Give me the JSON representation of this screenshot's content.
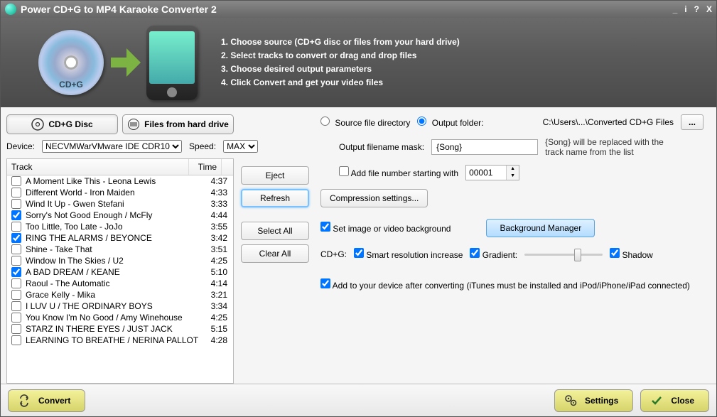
{
  "title": "Power CD+G to MP4 Karaoke Converter 2",
  "steps": [
    "1. Choose source (CD+G disc or files from your hard drive)",
    "2. Select tracks to convert or drag and drop files",
    "3. Choose desired output parameters",
    "4. Click Convert and get your video files"
  ],
  "source_buttons": {
    "disc": "CD+G Disc",
    "files": "Files from hard drive"
  },
  "device_label": "Device:",
  "device_value": "NECVMWarVMware IDE CDR10",
  "speed_label": "Speed:",
  "speed_value": "MAX",
  "columns": {
    "track": "Track",
    "time": "Time"
  },
  "tracks": [
    {
      "name": "A Moment Like This - Leona Lewis",
      "time": "4:37",
      "checked": false
    },
    {
      "name": "Different World - Iron Maiden",
      "time": "4:33",
      "checked": false
    },
    {
      "name": "Wind It Up - Gwen Stefani",
      "time": "3:33",
      "checked": false
    },
    {
      "name": "Sorry's Not Good Enough / McFly",
      "time": "4:44",
      "checked": true
    },
    {
      "name": "Too Little, Too Late - JoJo",
      "time": "3:55",
      "checked": false
    },
    {
      "name": "RING THE ALARMS / BEYONCE",
      "time": "3:42",
      "checked": true
    },
    {
      "name": "Shine - Take That",
      "time": "3:51",
      "checked": false
    },
    {
      "name": "Window In The Skies / U2",
      "time": "4:25",
      "checked": false
    },
    {
      "name": "A BAD DREAM / KEANE",
      "time": "5:10",
      "checked": true
    },
    {
      "name": "Raoul - The Automatic",
      "time": "4:14",
      "checked": false
    },
    {
      "name": "Grace Kelly - Mika",
      "time": "3:21",
      "checked": false
    },
    {
      "name": "I LUV U / THE ORDINARY BOYS",
      "time": "3:34",
      "checked": false
    },
    {
      "name": "You Know I'm No Good / Amy Winehouse",
      "time": "4:25",
      "checked": false
    },
    {
      "name": "STARZ IN THERE EYES / JUST JACK",
      "time": "5:15",
      "checked": false
    },
    {
      "name": "LEARNING TO BREATHE / NERINA PALLOT",
      "time": "4:28",
      "checked": false
    }
  ],
  "mid_buttons": {
    "eject": "Eject",
    "refresh": "Refresh",
    "select_all": "Select All",
    "clear_all": "Clear All"
  },
  "output": {
    "source_dir_label": "Source file directory",
    "output_folder_label": "Output folder:",
    "output_path": "C:\\Users\\...\\Converted CD+G Files",
    "mask_label": "Output filename mask:",
    "mask_value": "{Song}",
    "mask_hint": "{Song} will be replaced with the track name from the list",
    "add_number_label": "Add file number starting with",
    "add_number_value": "00001",
    "compression_btn": "Compression settings...",
    "set_bg_label": "Set image or video background",
    "bg_manager_btn": "Background Manager",
    "cdg_label": "CD+G:",
    "smart_res_label": "Smart resolution increase",
    "gradient_label": "Gradient:",
    "shadow_label": "Shadow",
    "add_device_label": "Add to your device after converting (iTunes must be installed and iPod/iPhone/iPad connected)",
    "output_selected": "output"
  },
  "footer": {
    "convert": "Convert",
    "settings": "Settings",
    "close": "Close"
  },
  "disc_label": "CD+G"
}
